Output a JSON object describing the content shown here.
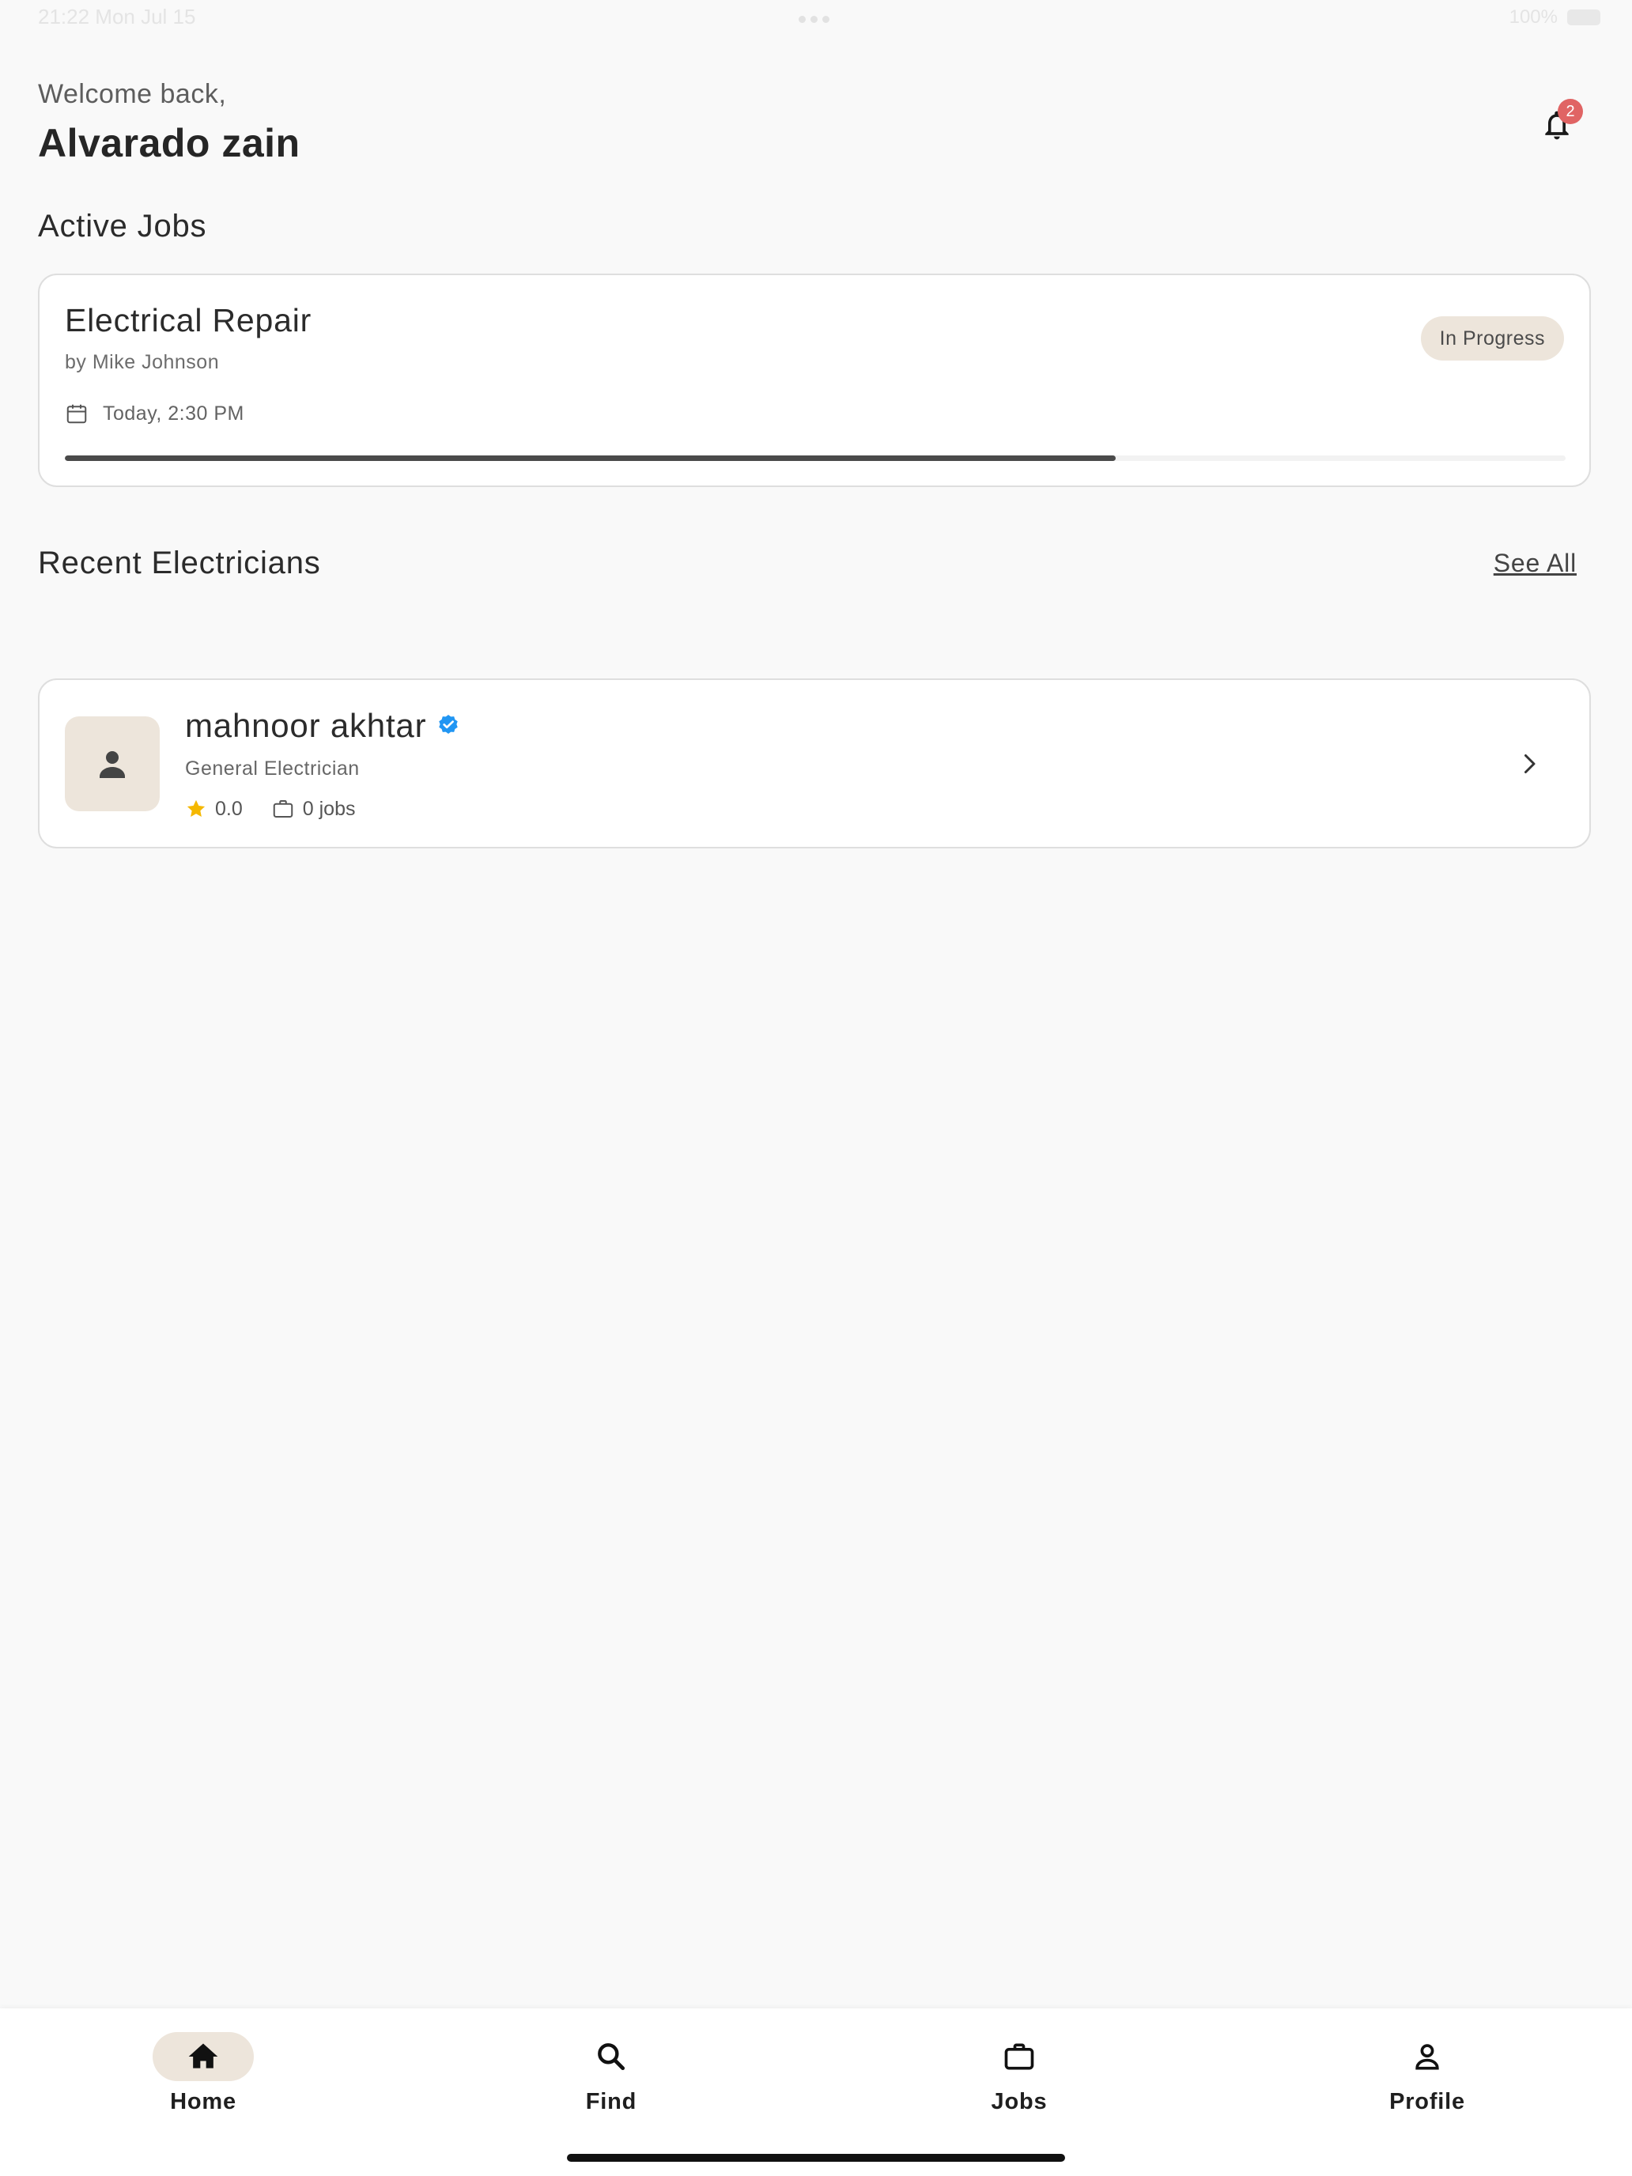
{
  "status_bar": {
    "time": "21:22  Mon Jul 15",
    "battery": "100%"
  },
  "header": {
    "greeting": "Welcome back,",
    "user_name": "Alvarado zain",
    "notification_count": "2"
  },
  "active_jobs": {
    "section_title": "Active Jobs",
    "job": {
      "title": "Electrical Repair",
      "by": "by Mike Johnson",
      "status": "In Progress",
      "time": "Today, 2:30 PM",
      "progress": 0.7
    }
  },
  "recent_electricians": {
    "section_title": "Recent Electricians",
    "see_all_label": "See All",
    "items": [
      {
        "name": "mahnoor akhtar",
        "role": "General Electrician",
        "rating": "0.0",
        "jobs": "0 jobs",
        "verified": true
      }
    ]
  },
  "bottom_nav": {
    "items": [
      {
        "label": "Home",
        "icon": "home-icon",
        "active": true
      },
      {
        "label": "Find",
        "icon": "search-icon",
        "active": false
      },
      {
        "label": "Jobs",
        "icon": "briefcase-icon",
        "active": false
      },
      {
        "label": "Profile",
        "icon": "person-icon",
        "active": false
      }
    ]
  },
  "colors": {
    "background": "#f9f9f9",
    "accent_beige": "#ede5db",
    "badge_red": "#e06464",
    "verified_blue": "#2196f3",
    "star_yellow": "#f5b800"
  }
}
